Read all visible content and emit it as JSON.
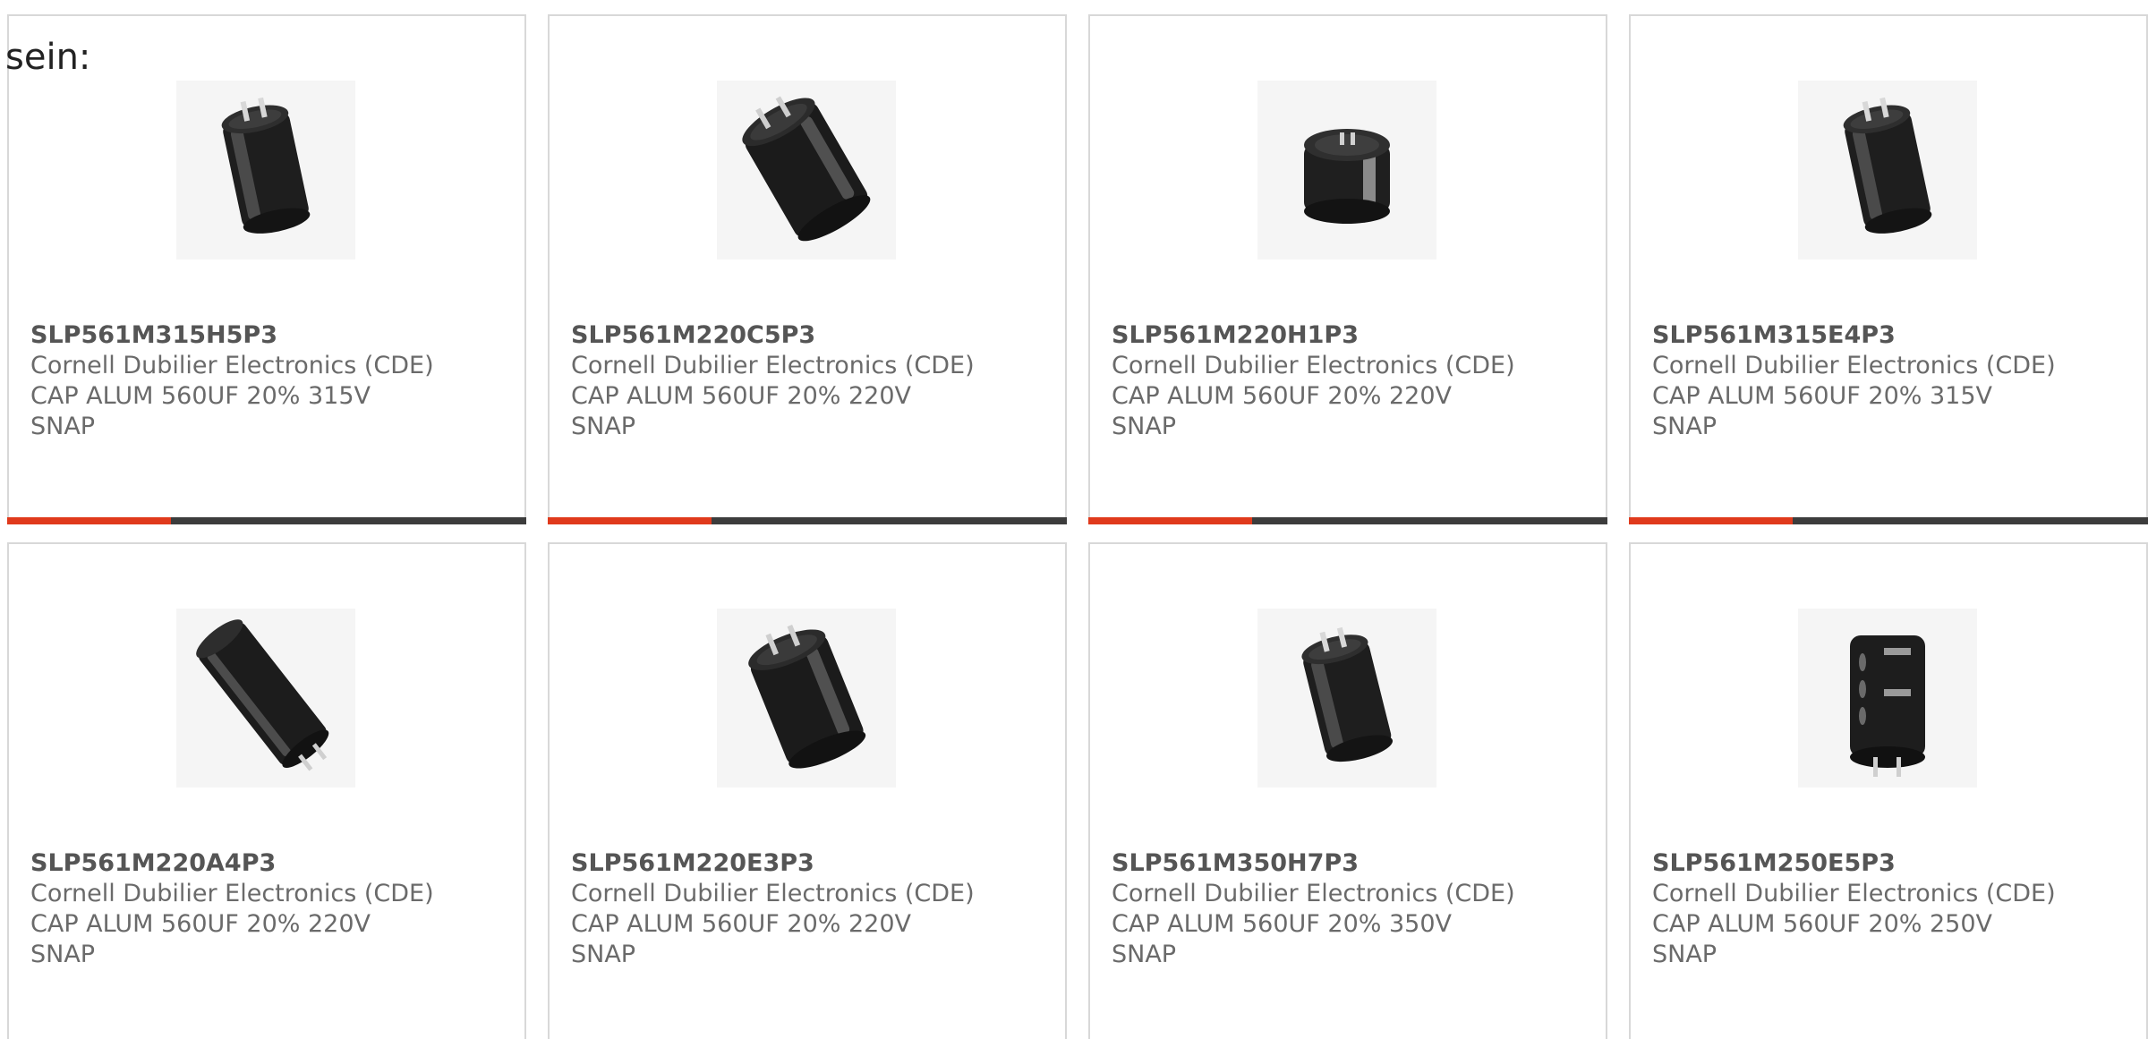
{
  "page": {
    "intro_text": "sein:"
  },
  "colors": {
    "accent": "#e03a1c",
    "bar": "#3c3c3c",
    "card_border": "#d8d8d8",
    "text": "#6a6a6a"
  },
  "products": [
    {
      "part_number": "SLP561M315H5P3",
      "manufacturer": "Cornell Dubilier Electronics (CDE)",
      "description": "CAP ALUM 560UF 20% 315V",
      "package": "SNAP",
      "image_icon": "capacitor-upright-icon"
    },
    {
      "part_number": "SLP561M220C5P3",
      "manufacturer": "Cornell Dubilier Electronics (CDE)",
      "description": "CAP ALUM 560UF 20% 220V",
      "package": "SNAP",
      "image_icon": "capacitor-tilted-icon"
    },
    {
      "part_number": "SLP561M220H1P3",
      "manufacturer": "Cornell Dubilier Electronics (CDE)",
      "description": "CAP ALUM 560UF 20% 220V",
      "package": "SNAP",
      "image_icon": "capacitor-short-icon"
    },
    {
      "part_number": "SLP561M315E4P3",
      "manufacturer": "Cornell Dubilier Electronics (CDE)",
      "description": "CAP ALUM 560UF 20% 315V",
      "package": "SNAP",
      "image_icon": "capacitor-upright-icon"
    },
    {
      "part_number": "SLP561M220A4P3",
      "manufacturer": "Cornell Dubilier Electronics (CDE)",
      "description": "CAP ALUM 560UF 20% 220V",
      "package": "SNAP",
      "image_icon": "capacitor-long-icon"
    },
    {
      "part_number": "SLP561M220E3P3",
      "manufacturer": "Cornell Dubilier Electronics (CDE)",
      "description": "CAP ALUM 560UF 20% 220V",
      "package": "SNAP",
      "image_icon": "capacitor-tilted-icon"
    },
    {
      "part_number": "SLP561M350H7P3",
      "manufacturer": "Cornell Dubilier Electronics (CDE)",
      "description": "CAP ALUM 560UF 20% 350V",
      "package": "SNAP",
      "image_icon": "capacitor-upright-icon"
    },
    {
      "part_number": "SLP561M250E5P3",
      "manufacturer": "Cornell Dubilier Electronics (CDE)",
      "description": "CAP ALUM 560UF 20% 250V",
      "package": "SNAP",
      "image_icon": "capacitor-front-icon"
    }
  ]
}
